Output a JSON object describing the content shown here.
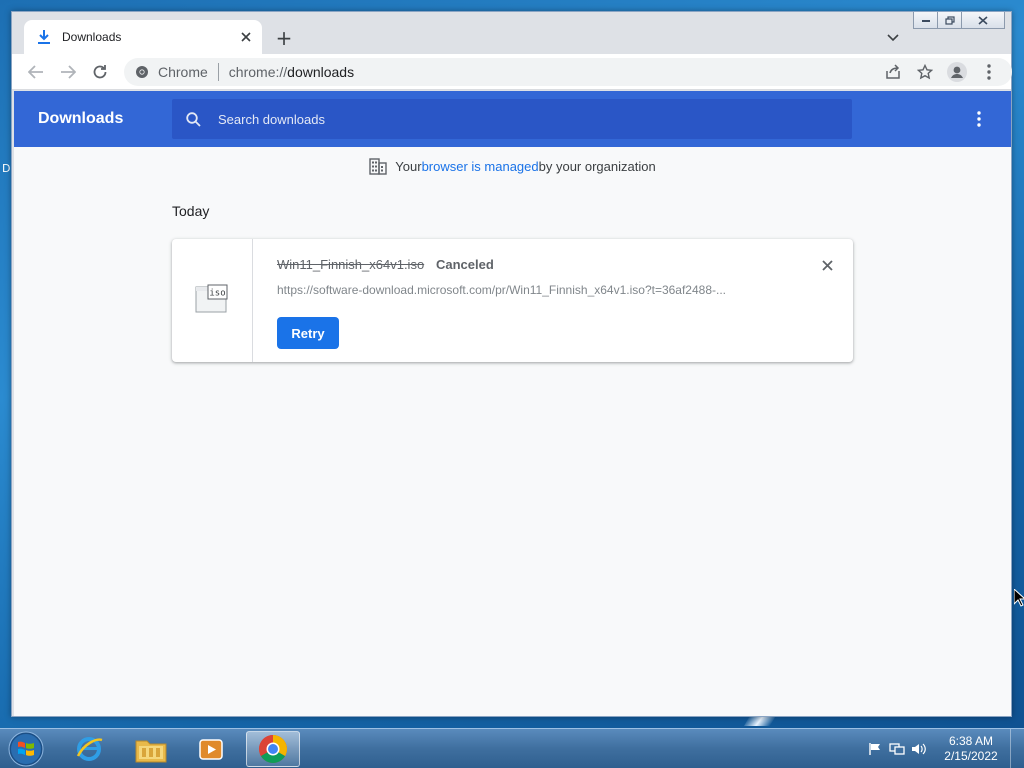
{
  "desktop": {
    "edge_letter": "D"
  },
  "browser": {
    "tab": {
      "title": "Downloads",
      "icon": "download-icon"
    },
    "new_tab_symbol": "+",
    "omnibox": {
      "chip_label": "Chrome",
      "url_scheme": "chrome://",
      "url_path": "downloads"
    }
  },
  "downloads_page": {
    "header_title": "Downloads",
    "search_placeholder": "Search downloads",
    "managed_notice": {
      "prefix": "Your ",
      "link": "browser is managed",
      "suffix": " by your organization"
    },
    "section_label": "Today",
    "items": [
      {
        "file_name": "Win11_Finnish_x64v1.iso",
        "status": "Canceled",
        "url": "https://software-download.microsoft.com/pr/Win11_Finnish_x64v1.iso?t=36af2488-...",
        "action_label": "Retry",
        "file_icon_label": "iso"
      }
    ]
  },
  "taskbar": {
    "apps": [
      "internet-explorer-icon",
      "file-explorer-icon",
      "media-player-icon",
      "chrome-icon"
    ],
    "active_app": "chrome-icon",
    "clock_time": "6:38 AM",
    "clock_date": "2/15/2022"
  },
  "colors": {
    "header_blue": "#3367d6",
    "search_blue": "#2a56c6",
    "link_blue": "#1a73e8",
    "retry_blue": "#1a73e8"
  }
}
